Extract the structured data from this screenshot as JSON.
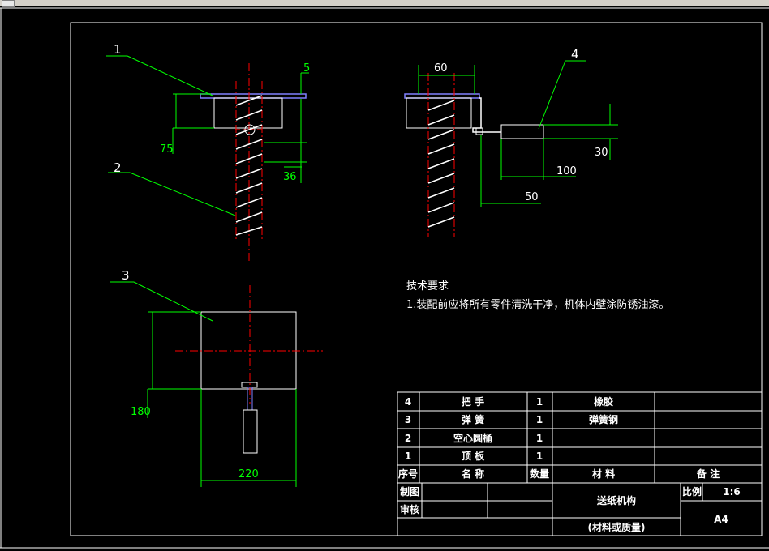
{
  "drawing": {
    "leaders": [
      "1",
      "2",
      "3",
      "4"
    ],
    "dimensions": {
      "d5": "5",
      "d75": "75",
      "d36": "36",
      "d60": "60",
      "d30": "30",
      "d100": "100",
      "d50": "50",
      "d180": "180",
      "d220": "220"
    },
    "notes": {
      "heading": "技术要求",
      "line1": "1.装配前应将所有零件清洗干净，机体内壁涂防锈油漆。"
    }
  },
  "title_block": {
    "bom": [
      {
        "no": "4",
        "name": "把          手",
        "qty": "1",
        "material": "橡胶",
        "remark": ""
      },
      {
        "no": "3",
        "name": "弹          簧",
        "qty": "1",
        "material": "弹簧钢",
        "remark": ""
      },
      {
        "no": "2",
        "name": "空心圆桶",
        "qty": "1",
        "material": "",
        "remark": ""
      },
      {
        "no": "1",
        "name": "顶          板",
        "qty": "1",
        "material": "",
        "remark": ""
      }
    ],
    "header": {
      "no": "序号",
      "name": "名          称",
      "qty": "数量",
      "material": "材          料",
      "remark": "备          注"
    },
    "drawn_by": "制图",
    "checked_by": "审核",
    "title": "送纸机构",
    "material_mass": "(材料或质量)",
    "scale_label": "比例",
    "scale_value": "1:6",
    "sheet": "A4"
  },
  "colors": {
    "frame": "#ffffff",
    "dimension": "#00ff00",
    "centerline": "#ff0000",
    "part": "#ffffff",
    "plate": "#8080ff"
  }
}
